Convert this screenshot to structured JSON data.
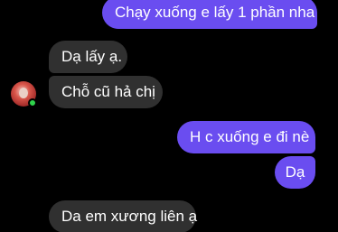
{
  "colors": {
    "background": "#000000",
    "outgoing_bubble": "#6a4df0",
    "incoming_bubble": "#303030",
    "online": "#2fd34b"
  },
  "contact": {
    "avatar_icon": "contact-avatar-photo",
    "status_icon": "online-status-dot"
  },
  "messages": [
    {
      "direction": "outgoing",
      "text": "Chạy xuống e lấy 1 phần nha"
    },
    {
      "direction": "incoming",
      "text": "Dạ lấy ạ."
    },
    {
      "direction": "incoming",
      "text": "Chỗ cũ hả chị"
    },
    {
      "direction": "outgoing",
      "text": "H c xuống e đi nè"
    },
    {
      "direction": "outgoing",
      "text": "Dạ"
    },
    {
      "direction": "incoming",
      "text": "Da em xương liên ạ"
    }
  ]
}
